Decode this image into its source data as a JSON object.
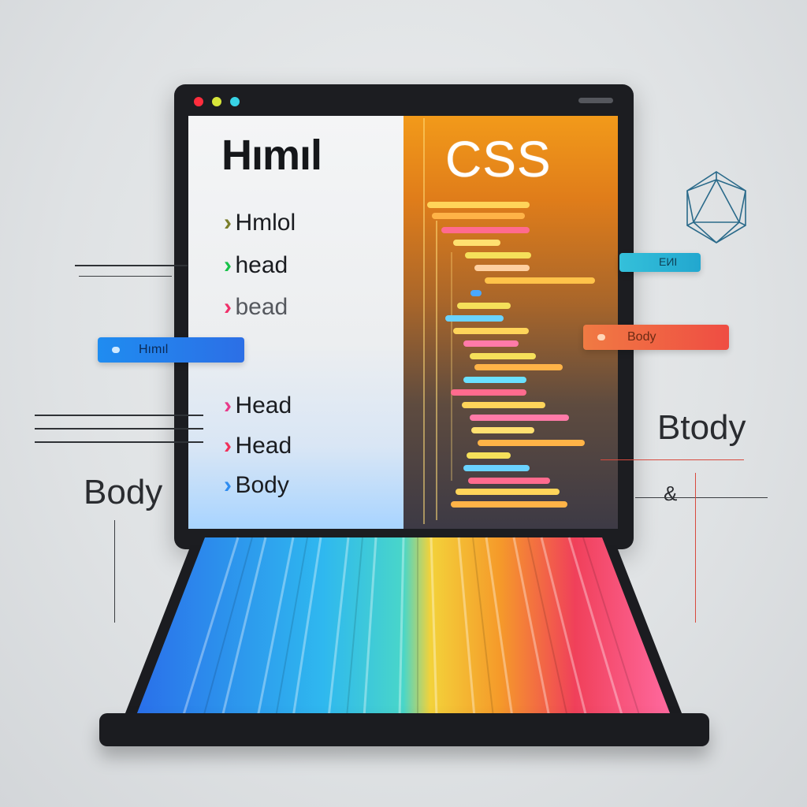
{
  "html_panel": {
    "title": "Hımıl",
    "items": [
      {
        "label": "Hmlol",
        "chevron_color": "#7a7e2a"
      },
      {
        "label": "head",
        "chevron_color": "#18c24a"
      },
      {
        "label": "bead",
        "chevron_color": "#f0306a"
      },
      {
        "label": "Head",
        "chevron_color": "#e83a8a"
      },
      {
        "label": "Head",
        "chevron_color": "#f0305a"
      },
      {
        "label": "Body",
        "chevron_color": "#2f8cf0"
      }
    ]
  },
  "css_panel": {
    "title": "CSS"
  },
  "floating_labels": {
    "left_pill": "Hımıl",
    "right_pill": "Body",
    "cyan_pill": "ЕИI"
  },
  "side_text": {
    "left": "Body",
    "right": "Btody",
    "ampersand": "&"
  },
  "colors": {
    "frame": "#1c1d21",
    "css_orange": "#f29a1a",
    "accent_blue": "#1f8cf0",
    "accent_red": "#ef4d43"
  },
  "icons": [
    "window-dot-red",
    "window-dot-yellow",
    "window-dot-cyan",
    "chevron-right-icon",
    "polyhedron-icon"
  ]
}
